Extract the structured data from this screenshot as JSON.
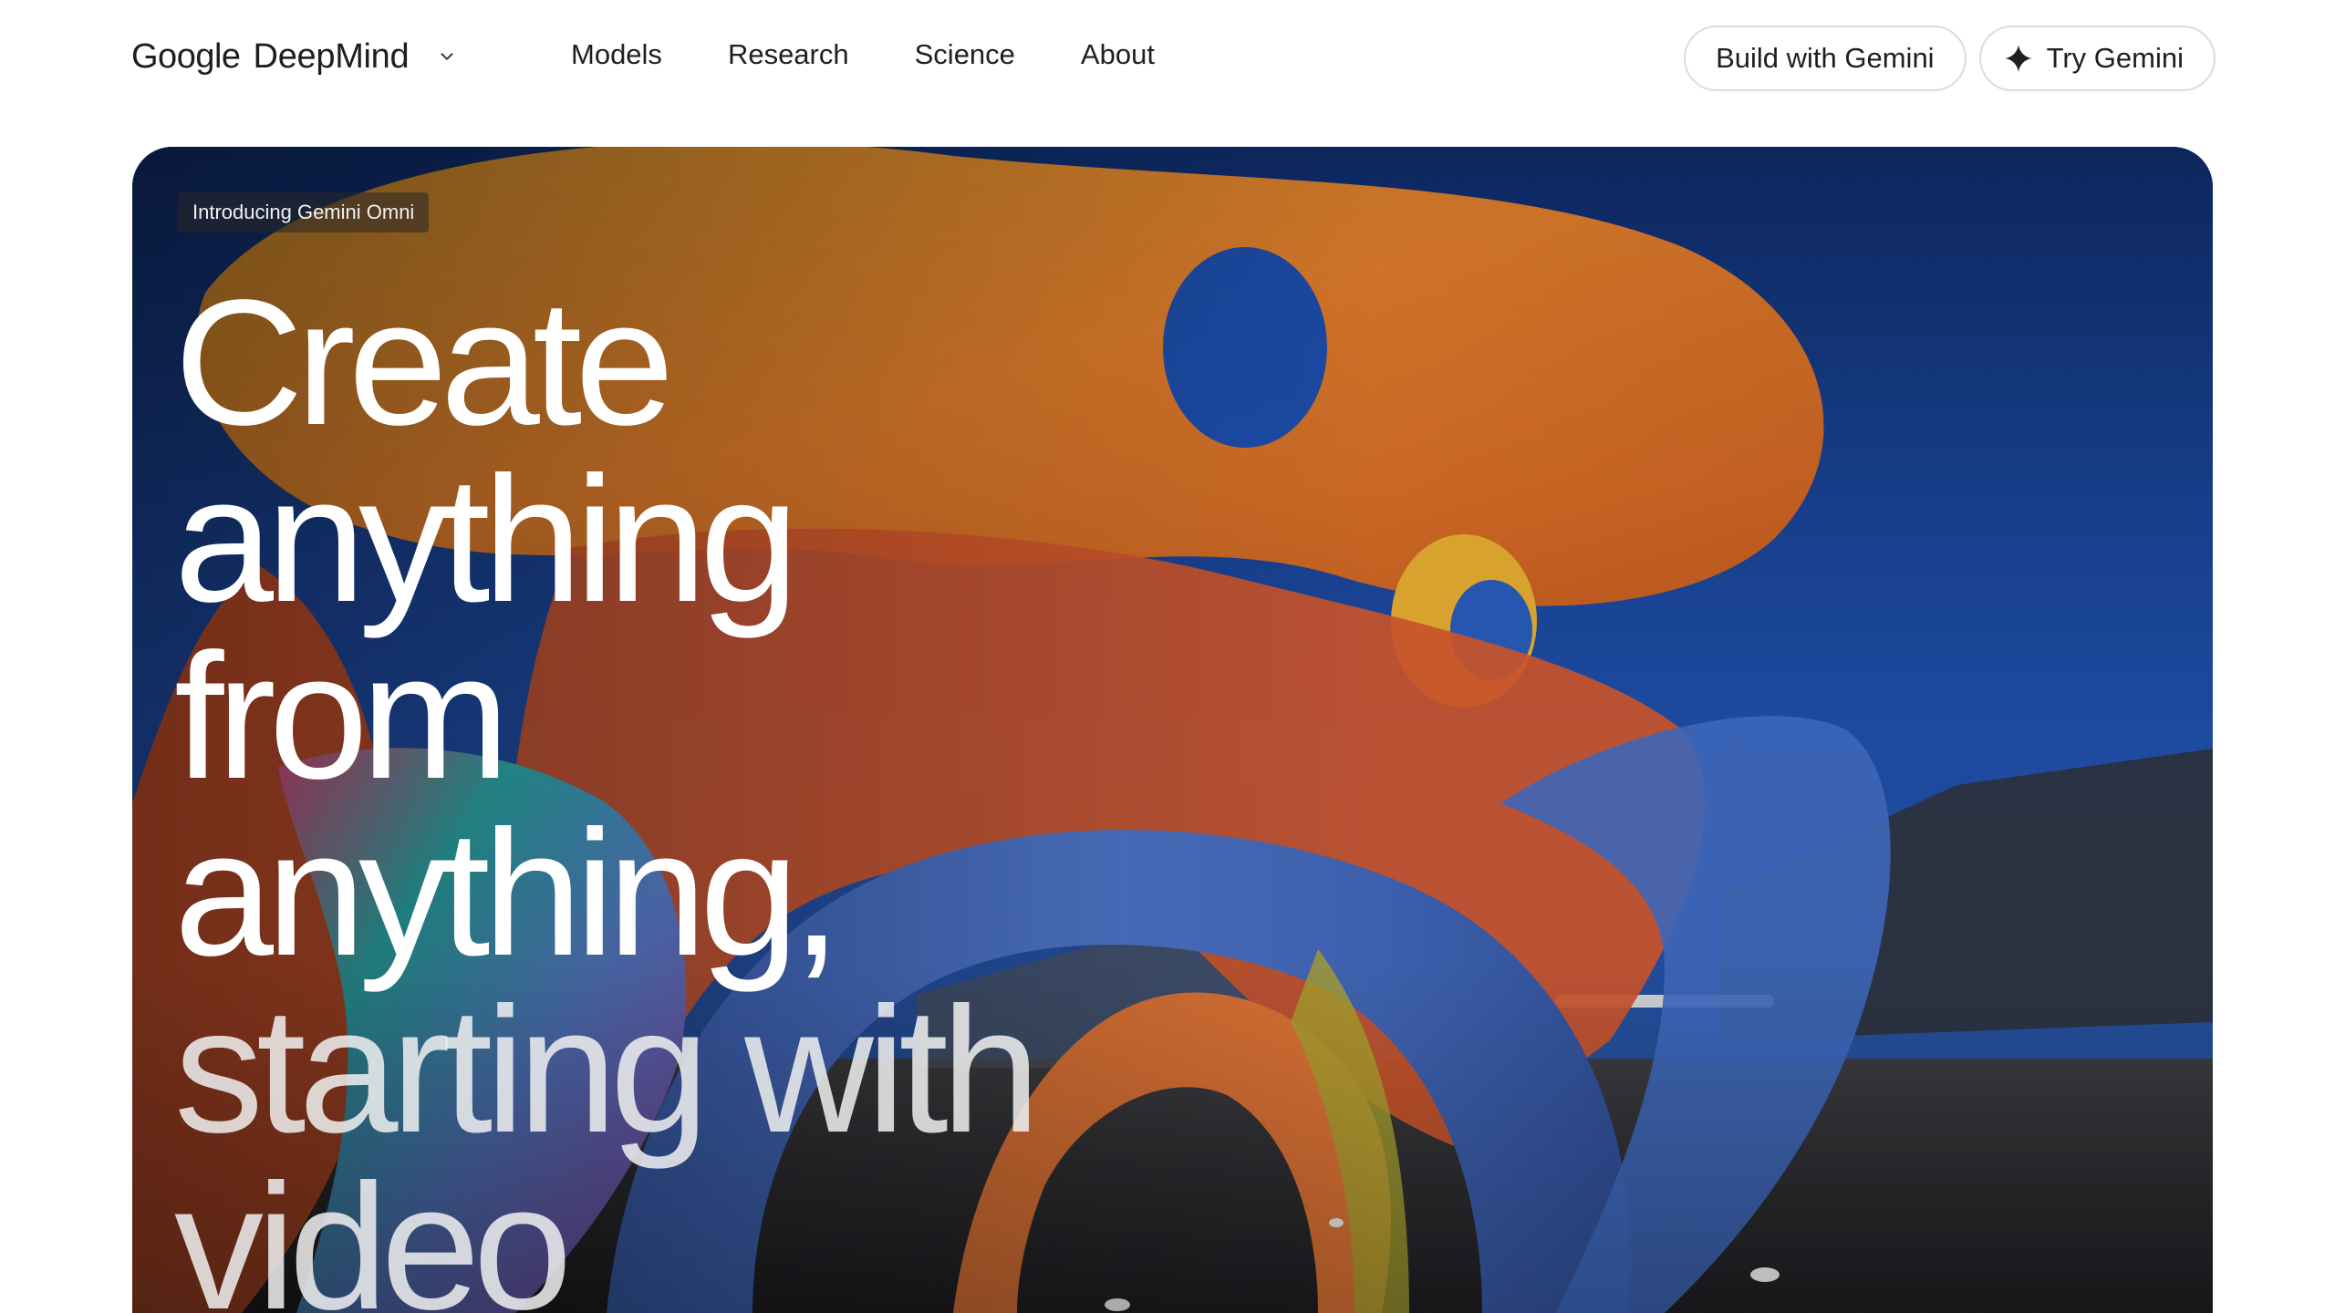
{
  "header": {
    "brand": {
      "google": "Google",
      "deepmind": "DeepMind",
      "menu_icon": "chevron-down-icon"
    },
    "nav": [
      {
        "label": "Models"
      },
      {
        "label": "Research"
      },
      {
        "label": "Science"
      },
      {
        "label": "About"
      }
    ],
    "actions": {
      "build_label": "Build with Gemini",
      "try_label": "Try Gemini",
      "try_icon": "sparkle-icon"
    }
  },
  "hero": {
    "eyebrow": "Introducing Gemini Omni",
    "headline_lines": [
      "Create",
      "anything",
      "from",
      "anything,",
      "starting with",
      "video"
    ],
    "media": "knit-sculpture-image"
  },
  "colors": {
    "text": "#1f1f1f",
    "pill_border": "#dadce0",
    "hero_sky": "#1a3a7a"
  }
}
